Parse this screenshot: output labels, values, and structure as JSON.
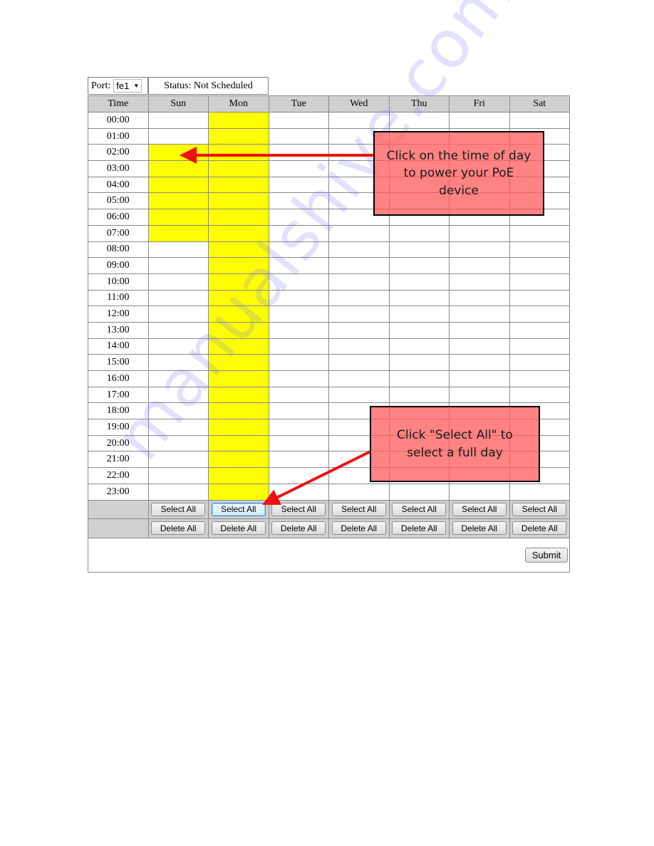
{
  "port": {
    "label": "Port:",
    "value": "fe1"
  },
  "status": {
    "text": "Status: Not Scheduled"
  },
  "grid": {
    "headers": [
      "Time",
      "Sun",
      "Mon",
      "Tue",
      "Wed",
      "Thu",
      "Fri",
      "Sat"
    ],
    "times": [
      "00:00",
      "01:00",
      "02:00",
      "03:00",
      "04:00",
      "05:00",
      "06:00",
      "07:00",
      "08:00",
      "09:00",
      "10:00",
      "11:00",
      "12:00",
      "13:00",
      "14:00",
      "15:00",
      "16:00",
      "17:00",
      "18:00",
      "19:00",
      "20:00",
      "21:00",
      "22:00",
      "23:00"
    ],
    "selected": {
      "Sun": [
        "02:00",
        "03:00",
        "04:00",
        "05:00",
        "06:00",
        "07:00"
      ],
      "Mon": [
        "00:00",
        "01:00",
        "02:00",
        "03:00",
        "04:00",
        "05:00",
        "06:00",
        "07:00",
        "08:00",
        "09:00",
        "10:00",
        "11:00",
        "12:00",
        "13:00",
        "14:00",
        "15:00",
        "16:00",
        "17:00",
        "18:00",
        "19:00",
        "20:00",
        "21:00",
        "22:00",
        "23:00"
      ],
      "Tue": [],
      "Wed": [],
      "Thu": [],
      "Fri": [],
      "Sat": []
    },
    "select_all_label": "Select All",
    "delete_all_label": "Delete All",
    "focused_select_all_day": "Mon"
  },
  "submit_label": "Submit",
  "colors": {
    "selected": "#ffff00",
    "header": "#d0d0d0",
    "callout": "#ff7a7a",
    "arrow": "#ee1111"
  },
  "annotations": {
    "callout_1": "Click on the time of day to power your PoE device",
    "callout_2": "Click \"Select All\" to select a full day"
  },
  "watermark": "manualshive.com"
}
